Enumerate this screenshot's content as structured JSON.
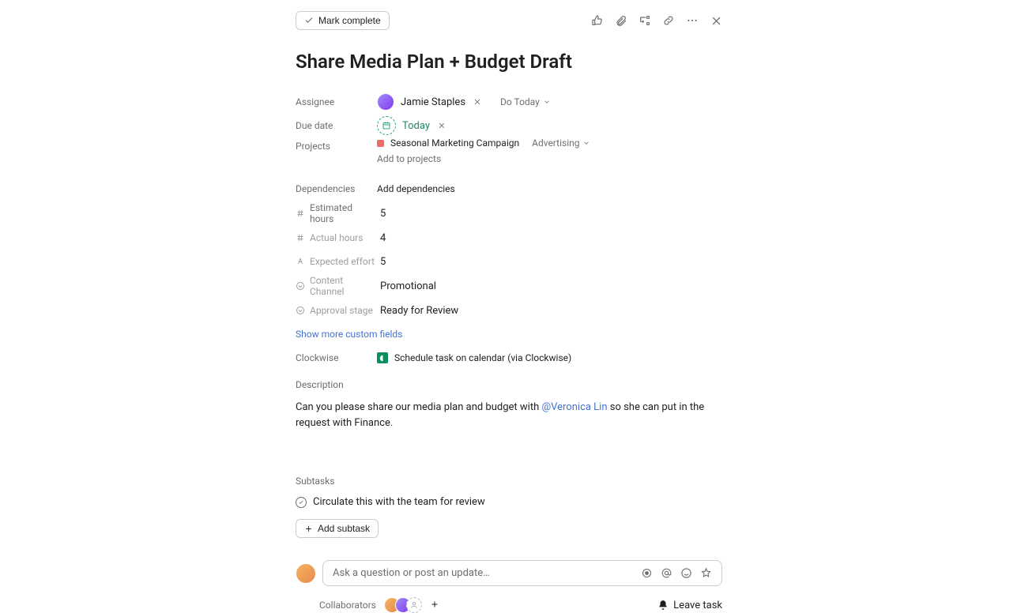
{
  "toolbar": {
    "mark_complete_label": "Mark complete"
  },
  "task": {
    "title": "Share Media Plan + Budget Draft"
  },
  "fields": {
    "assignee_label": "Assignee",
    "assignee_name": "Jamie Staples",
    "do_today_label": "Do Today",
    "due_date_label": "Due date",
    "due_date_value": "Today",
    "projects_label": "Projects",
    "project_name": "Seasonal Marketing Campaign",
    "project_section": "Advertising",
    "add_to_projects": "Add to projects",
    "dependencies_label": "Dependencies",
    "add_dependencies": "Add dependencies",
    "estimated_hours_label": "Estimated hours",
    "estimated_hours_value": "5",
    "actual_hours_label": "Actual hours",
    "actual_hours_value": "4",
    "expected_effort_label": "Expected effort",
    "expected_effort_value": "5",
    "content_channel_label": "Content Channel",
    "content_channel_value": "Promotional",
    "approval_stage_label": "Approval stage",
    "approval_stage_value": "Ready for Review",
    "show_more_label": "Show more custom fields",
    "clockwise_label": "Clockwise",
    "clockwise_action": "Schedule task on calendar (via Clockwise)",
    "description_label": "Description"
  },
  "description": {
    "before": "Can you please share our media plan and budget with ",
    "mention": "@Veronica Lin",
    "after": " so she can put in the request with Finance."
  },
  "subtasks": {
    "label": "Subtasks",
    "items": [
      "Circulate this with the team for review"
    ],
    "add_label": "Add subtask"
  },
  "comment": {
    "placeholder": "Ask a question or post an update…"
  },
  "footer": {
    "collaborators_label": "Collaborators",
    "leave_task_label": "Leave task"
  },
  "colors": {
    "project_dot": "#f06a6a",
    "due_green": "#258564",
    "link_blue": "#4573d2"
  }
}
